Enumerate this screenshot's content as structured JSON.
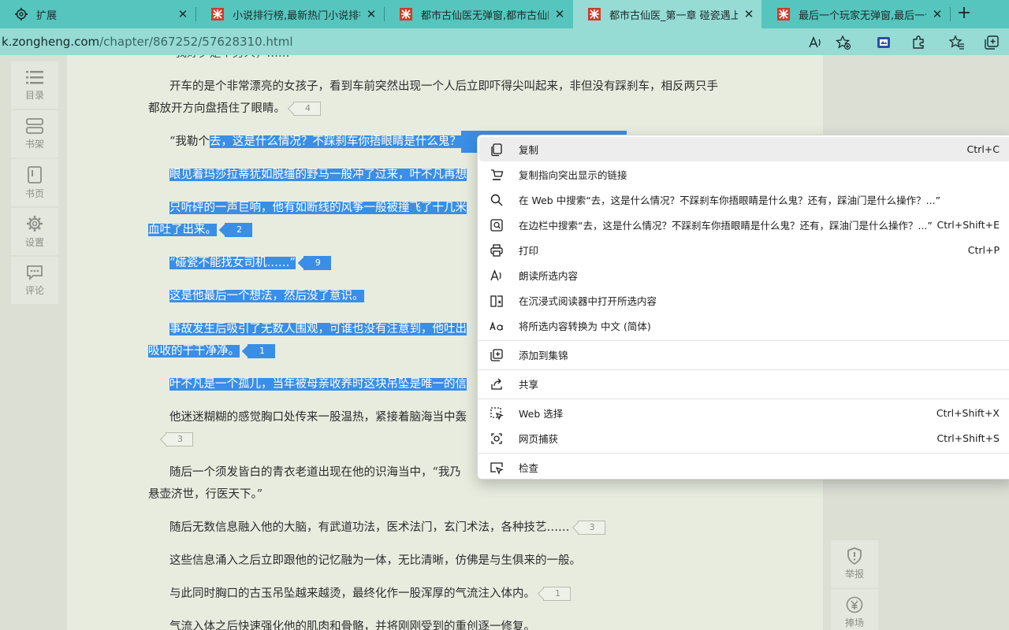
{
  "tabs": [
    {
      "title": "扩展",
      "active": false,
      "favicon": "gear-icon"
    },
    {
      "title": "小说排行榜,最新热门小说排行榜",
      "active": false,
      "favicon": "zongheng-icon"
    },
    {
      "title": "都市古仙医无弹窗,都市古仙医最新",
      "active": false,
      "favicon": "zongheng-icon"
    },
    {
      "title": "都市古仙医_第一章 碰瓷遇上女司机",
      "active": true,
      "favicon": "zongheng-icon"
    },
    {
      "title": "最后一个玩家无弹窗,最后一个玩家",
      "active": false,
      "favicon": "zongheng-icon"
    }
  ],
  "address": {
    "host": "k.zongheng.com",
    "path": "/chapter/867252/57628310.html"
  },
  "left_nav": [
    {
      "label": "目录",
      "icon": "list-icon"
    },
    {
      "label": "书架",
      "icon": "bookshelf-icon"
    },
    {
      "label": "书页",
      "icon": "book-icon"
    },
    {
      "label": "设置",
      "icon": "gear-icon"
    },
    {
      "label": "评论",
      "icon": "comment-icon"
    }
  ],
  "paragraphs": {
    "p0": "“我好歹是个男人，……”",
    "p1a": "开车的是个非常漂亮的女孩子，看到车前突然出现一个人后立即吓得尖叫起来，非但没有踩刹车，相反两只手",
    "p1b": "都放开方向盘捂住了眼睛。",
    "p1c": "4",
    "p2a": "“我勒个",
    "p2b": "去，这是什么情况？不踩刹车你捂眼睛是什么鬼？",
    "p3": "眼见着玛莎拉蒂犹如脱缰的野马一般冲了过来，叶不凡再想",
    "p4a": "只听砰的一声巨响，他有如断线的风筝一般被撞飞了十几米",
    "p4b": "血吐了出来。",
    "p4c": "2",
    "p5a": "“碰瓷不能找女司机……”",
    "p5b": "9",
    "p6": "这是他最后一个想法，然后没了意识。",
    "p7a": "事故发生后吸引了无数人围观，可谁也没有注意到，他吐出",
    "p7b": "吸收的干干净净。",
    "p7c": "1",
    "p8": "叶不凡是一个孤儿，当年被母亲收养时这块吊坠是唯一的信",
    "p9a": "他迷迷糊糊的感觉胸口处传来一股温热，紧接着脑海当中轰",
    "p9b": "3",
    "p10a": "随后一个须发皆白的青衣老道出现在他的识海当中，“我乃",
    "p10b": "悬壶济世，行医天下。”",
    "p11a": "随后无数信息融入他的大脑，有武道功法，医术法门，玄门术法，各种技艺……",
    "p11b": "3",
    "p12": "这些信息涌入之后立即跟他的记忆融为一体，无比清晰，仿佛是与生俱来的一般。",
    "p13a": "与此同时胸口的古玉吊坠越来越烫，最终化作一股浑厚的气流注入体内。",
    "p13b": "1",
    "p14": "气流入体之后快速强化他的肌肉和骨骼，并将刚刚受到的重创逐一修复。"
  },
  "right_nav": [
    {
      "label": "举报",
      "icon": "shield-icon"
    },
    {
      "label": "捧场",
      "icon": "yen-icon"
    }
  ],
  "context_menu": [
    {
      "label": "复制",
      "shortcut": "Ctrl+C",
      "icon": "copy-icon"
    },
    {
      "label": "复制指向突出显示的链接",
      "shortcut": "",
      "icon": "link-highlight-icon"
    },
    {
      "label": "在 Web 中搜索“去，这是什么情况？不踩刹车你捂眼睛是什么鬼？还有，踩油门是什么操作？...”",
      "shortcut": "",
      "icon": "search-icon"
    },
    {
      "label": "在边栏中搜索“去，这是什么情况？不踩刹车你捂眼睛是什么鬼？还有，踩油门是什么操作？...”",
      "shortcut": "Ctrl+Shift+E",
      "icon": "sidebar-search-icon"
    },
    {
      "label": "打印",
      "shortcut": "Ctrl+P",
      "icon": "print-icon"
    },
    {
      "label": "朗读所选内容",
      "shortcut": "",
      "icon": "read-aloud-icon"
    },
    {
      "label": "在沉浸式阅读器中打开所选内容",
      "shortcut": "",
      "icon": "immersive-reader-icon"
    },
    {
      "label": "将所选内容转换为 中文 (简体)",
      "shortcut": "",
      "icon": "translate-icon"
    },
    {
      "label": "添加到集锦",
      "shortcut": "",
      "icon": "collections-icon"
    },
    {
      "label": "共享",
      "shortcut": "",
      "icon": "share-icon"
    },
    {
      "label": "Web 选择",
      "shortcut": "Ctrl+Shift+X",
      "icon": "web-select-icon"
    },
    {
      "label": "网页捕获",
      "shortcut": "Ctrl+Shift+S",
      "icon": "web-capture-icon"
    },
    {
      "label": "检查",
      "shortcut": "",
      "icon": "inspect-icon"
    }
  ],
  "colors": {
    "tabstrip": "#56c5bd",
    "toolbar": "#96dbd4",
    "selection": "#3a8ee6",
    "reader_bg": "#e7ecdf"
  }
}
